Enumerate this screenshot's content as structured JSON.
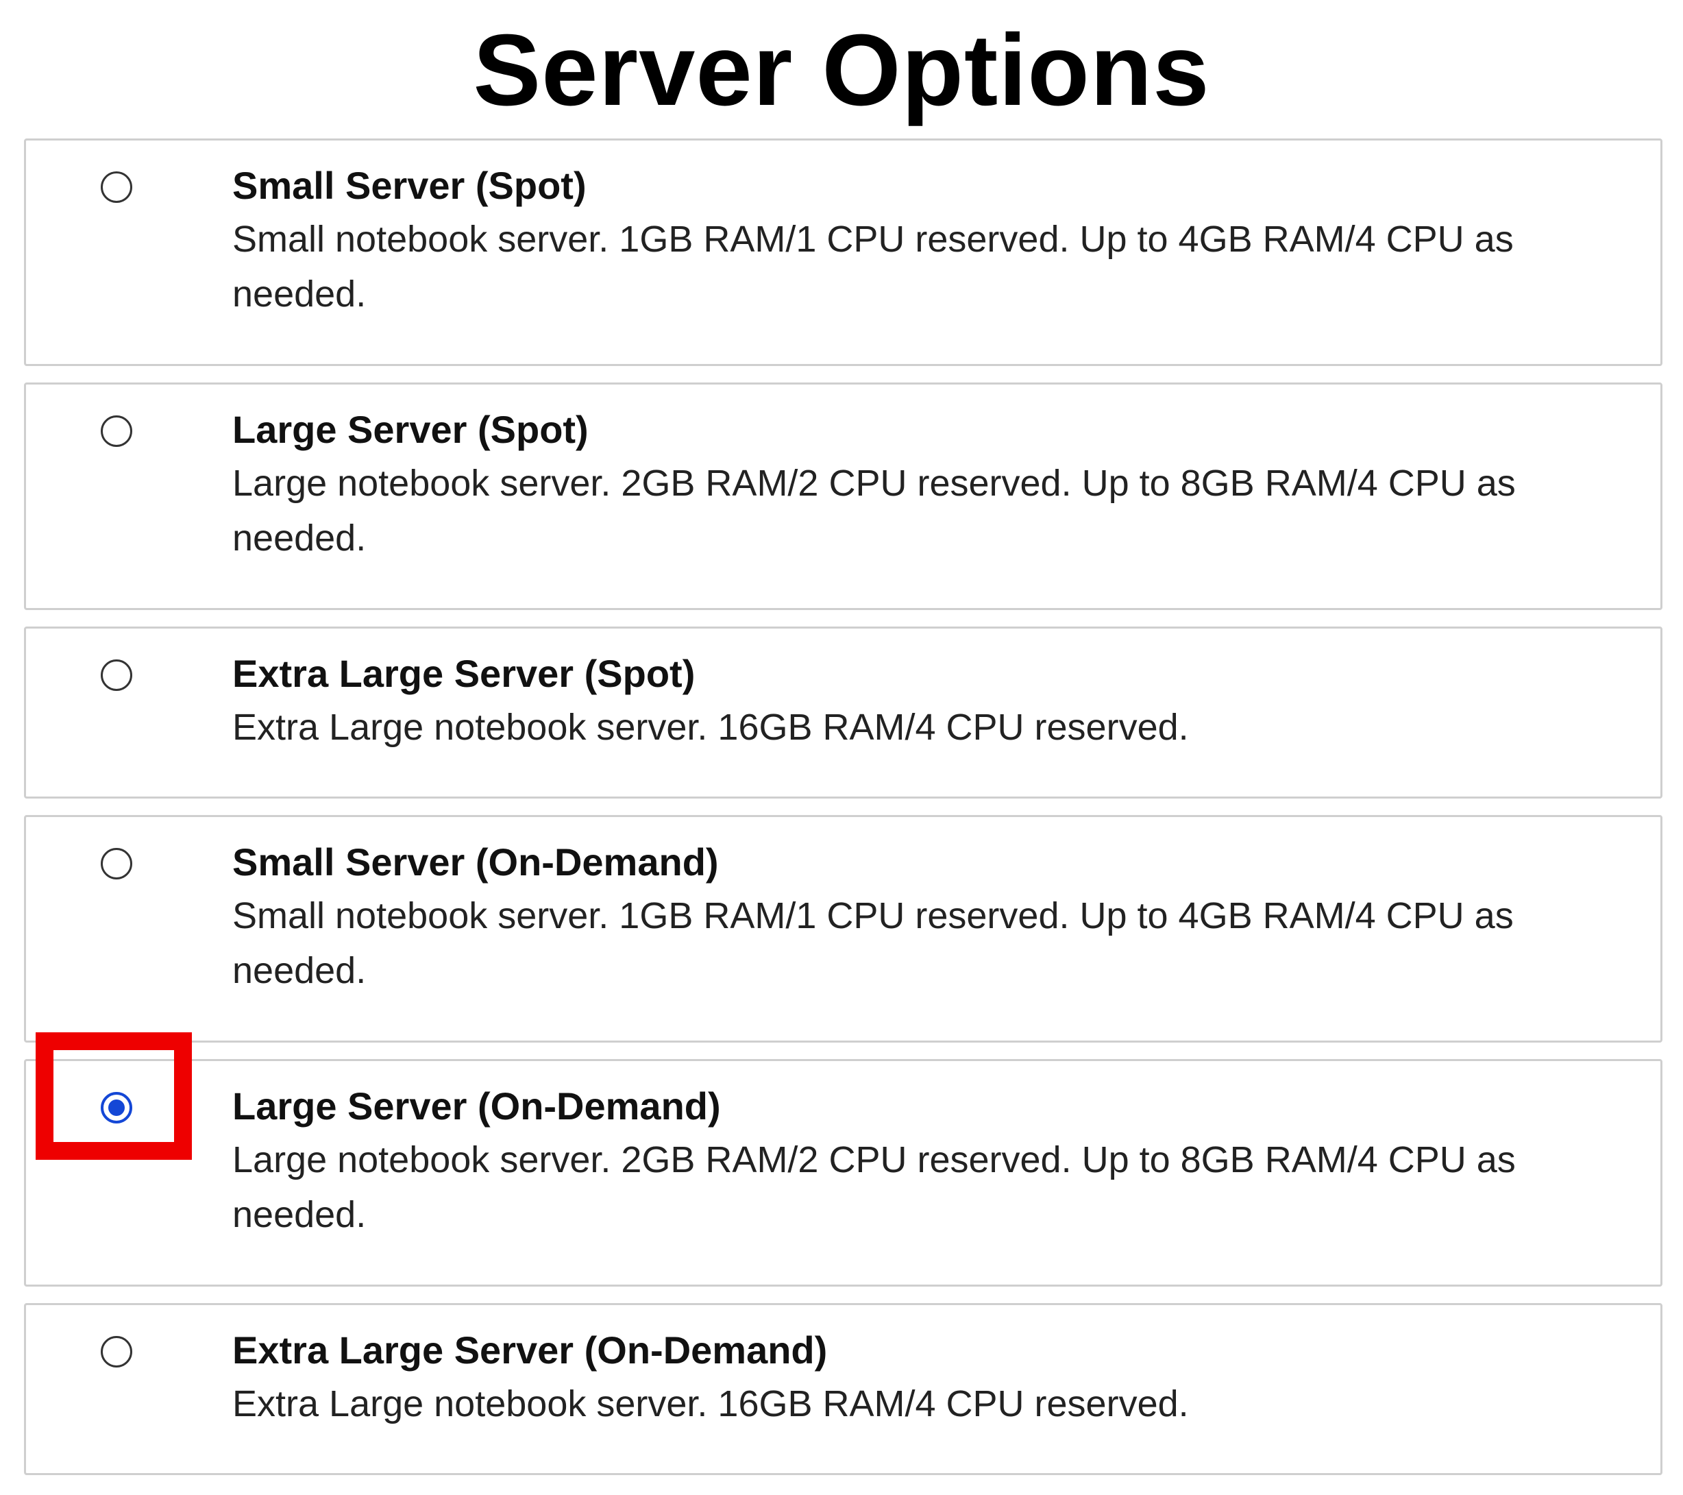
{
  "title": "Server Options",
  "options": [
    {
      "title": "Small Server (Spot)",
      "description": "Small notebook server. 1GB RAM/1 CPU reserved. Up to 4GB RAM/4 CPU as needed.",
      "selected": false
    },
    {
      "title": "Large Server (Spot)",
      "description": "Large notebook server. 2GB RAM/2 CPU reserved. Up to 8GB RAM/4 CPU as needed.",
      "selected": false
    },
    {
      "title": "Extra Large Server (Spot)",
      "description": "Extra Large notebook server. 16GB RAM/4 CPU reserved.",
      "selected": false
    },
    {
      "title": "Small Server (On-Demand)",
      "description": "Small notebook server. 1GB RAM/1 CPU reserved. Up to 4GB RAM/4 CPU as needed.",
      "selected": false
    },
    {
      "title": "Large Server (On-Demand)",
      "description": "Large notebook server. 2GB RAM/2 CPU reserved. Up to 8GB RAM/4 CPU as needed.",
      "selected": true
    },
    {
      "title": "Extra Large Server (On-Demand)",
      "description": "Extra Large notebook server. 16GB RAM/4 CPU reserved.",
      "selected": false
    }
  ],
  "colors": {
    "radio_selected": "#1447d6",
    "highlight_annotation": "#ee0000",
    "card_border": "#cfcfcf"
  }
}
